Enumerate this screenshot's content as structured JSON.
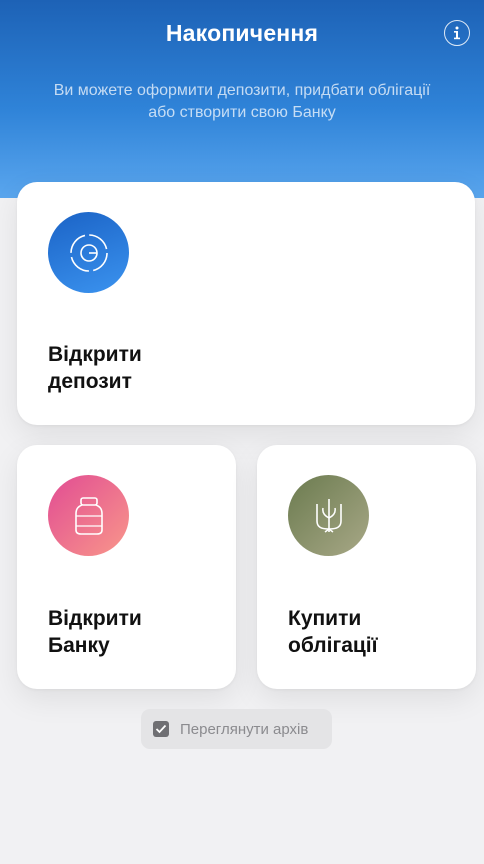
{
  "header": {
    "title": "Накопичення",
    "subtitle": "Ви можете оформити депозити, придбати облігації або створити свою Банку",
    "info_icon": "info-icon"
  },
  "cards": {
    "deposit": {
      "line1": "Відкрити",
      "line2": "депозит",
      "icon": "deposit-icon"
    },
    "jar": {
      "line1": "Відкрити",
      "line2": "Банку",
      "icon": "jar-icon"
    },
    "bonds": {
      "line1": "Купити",
      "line2": "облігації",
      "icon": "trident-icon"
    }
  },
  "archive": {
    "label": "Переглянути архів",
    "icon": "archive-checkbox-icon"
  },
  "colors": {
    "header_top": "#1d62b6",
    "header_bottom": "#5aa6ee",
    "deposit_icon": "#2a7ad8",
    "jar_icon_start": "#e14c93",
    "jar_icon_end": "#f9978a",
    "bonds_icon": "#8a9470"
  }
}
